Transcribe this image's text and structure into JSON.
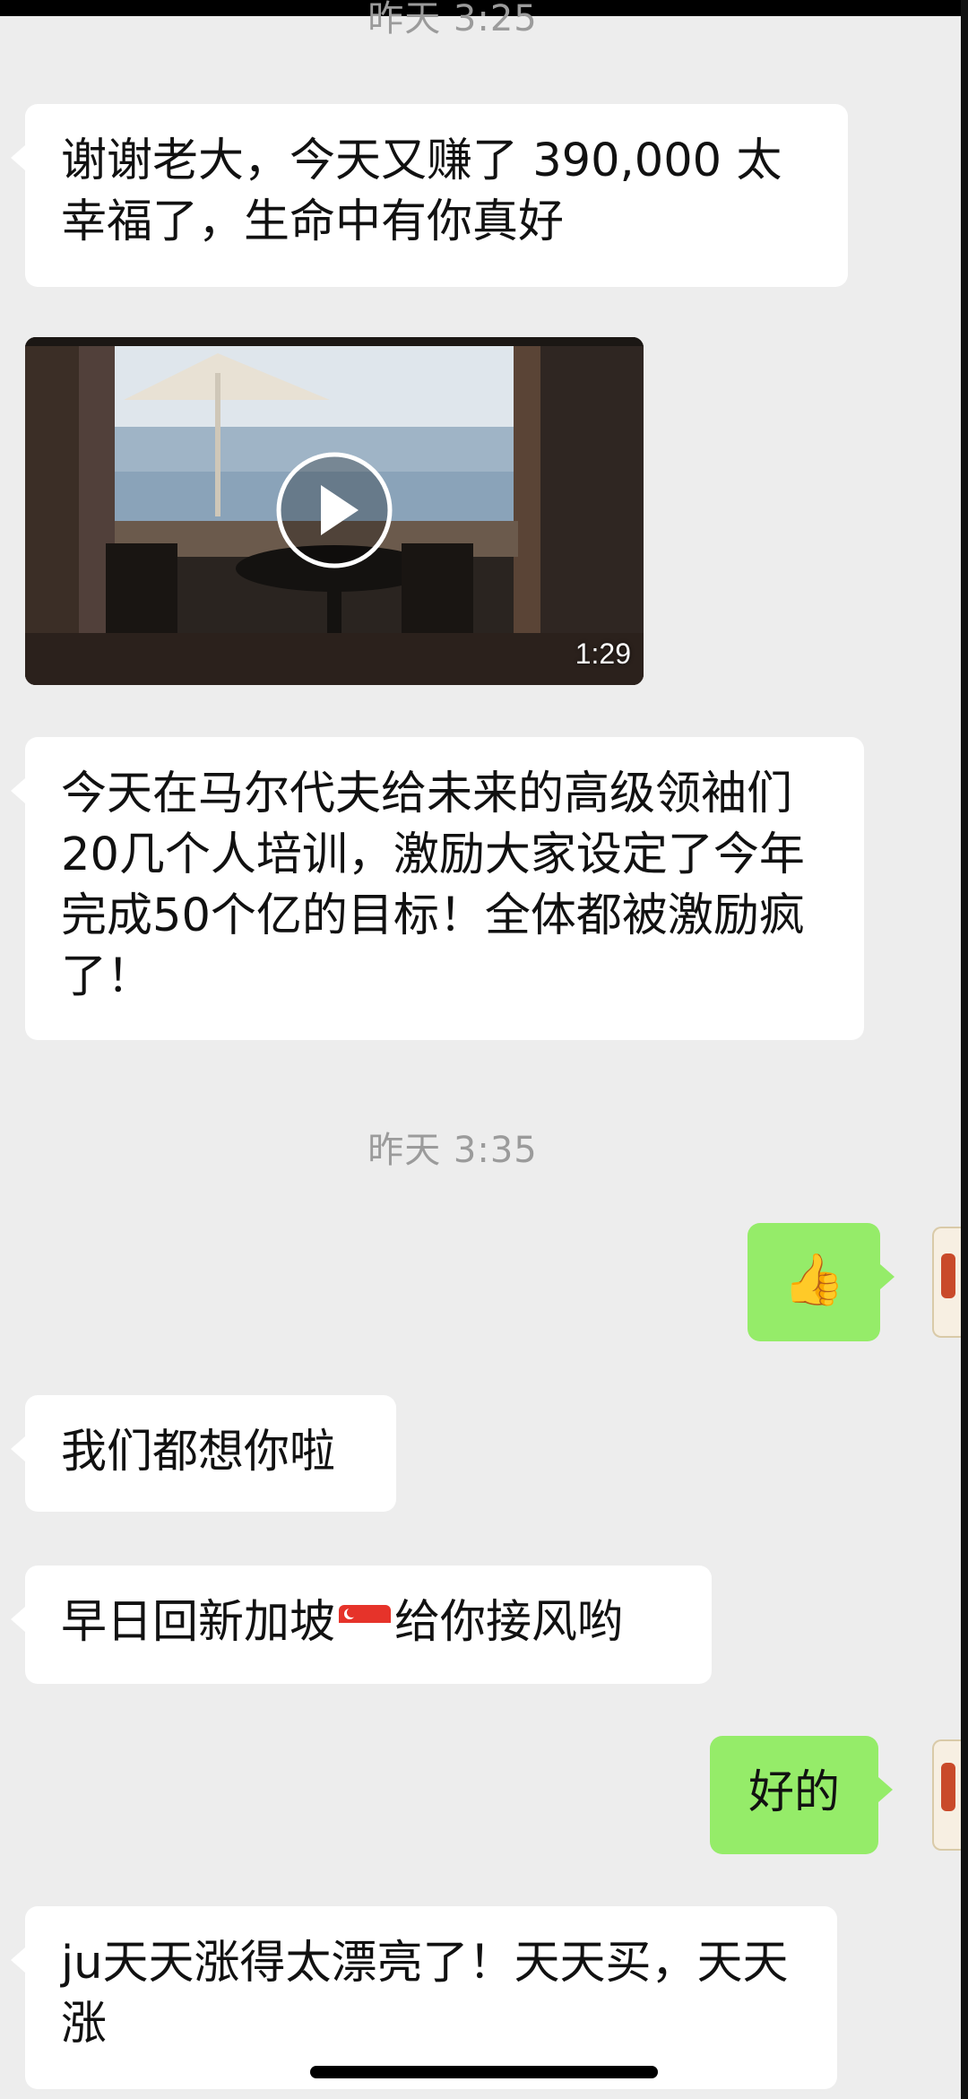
{
  "timestamps": {
    "first": "昨天 3:25",
    "second": "昨天 3:35"
  },
  "messages": {
    "m1": "谢谢老大，今天又赚了 390,000 太幸福了，生命中有你真好",
    "video_duration": "1:29",
    "m2": "今天在马尔代夫给未来的高级领袖们20几个人培训，激励大家设定了今年完成50个亿的目标！全体都被激励疯了！",
    "m3_emoji": "👍",
    "m4": "我们都想你啦",
    "m5_part1": "早日回新加坡",
    "m5_flag": "🇸🇬",
    "m5_part2": "给你接风哟",
    "m6": "好的",
    "m7": "ju天天涨得太漂亮了！天天买，天天涨"
  },
  "colors": {
    "background": "#ededed",
    "incoming_bubble": "#ffffff",
    "outgoing_bubble": "#95ec69",
    "timestamp_text": "#9b9b9b"
  },
  "icons": {
    "play": "play-icon",
    "thumbs_up": "thumbs-up-icon",
    "flag": "singapore-flag-icon"
  }
}
